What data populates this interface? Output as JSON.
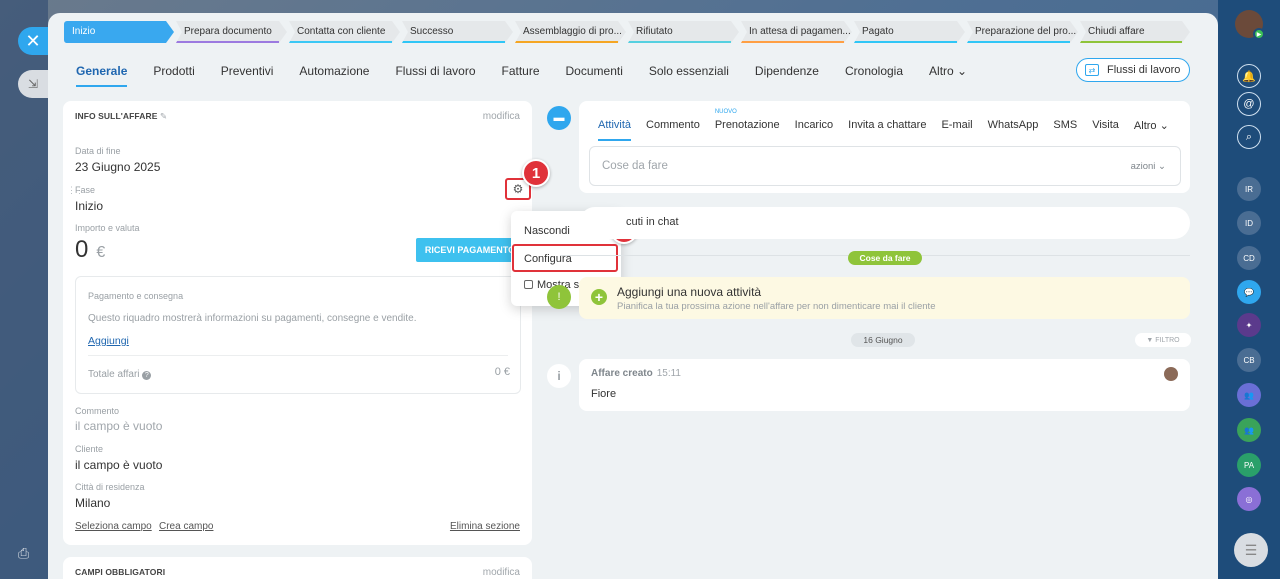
{
  "stages": [
    {
      "label": "Inizio",
      "color": "#39a8ef",
      "active": true
    },
    {
      "label": "Prepara documento",
      "color": "#9c7ae0"
    },
    {
      "label": "Contatta con cliente",
      "color": "#3bc8f5"
    },
    {
      "label": "Successo",
      "color": "#2fc6f6"
    },
    {
      "label": "Assemblaggio di pro...",
      "color": "#f5a623"
    },
    {
      "label": "Rifiutato",
      "color": "#55d0e0"
    },
    {
      "label": "In attesa di pagamen...",
      "color": "#ff9f43"
    },
    {
      "label": "Pagato",
      "color": "#2fc6f6"
    },
    {
      "label": "Preparazione del pro...",
      "color": "#2fc6f6"
    },
    {
      "label": "Chiudi affare",
      "color": "#8fc43a"
    }
  ],
  "tabs": [
    "Generale",
    "Prodotti",
    "Preventivi",
    "Automazione",
    "Flussi di lavoro",
    "Fatture",
    "Documenti",
    "Solo essenziali",
    "Dipendenze",
    "Cronologia",
    "Altro ⌄"
  ],
  "flows_button": "Flussi di lavoro",
  "info": {
    "title": "INFO SULL'AFFARE",
    "edit": "modifica",
    "end_date_label": "Data di fine",
    "end_date_value": "23 Giugno 2025",
    "stage_label": "Fase",
    "stage_value": "Inizio",
    "amount_label": "Importo e valuta",
    "amount_value": "0",
    "currency": "€",
    "pay_button": "RICEVI PAGAMENTO",
    "pay_box": {
      "title": "Pagamento e consegna",
      "desc": "Questo riquadro mostrerà informazioni su pagamenti, consegne e vendite.",
      "add": "Aggiungi",
      "total_label": "Totale affari",
      "total_value": "0 €"
    },
    "comment_label": "Commento",
    "comment_value": "il campo è vuoto",
    "client_label": "Cliente",
    "client_value": "il campo è vuoto",
    "city_label": "Città di residenza",
    "city_value": "Milano",
    "select_field": "Seleziona campo",
    "create_field": "Crea campo",
    "delete_section": "Elimina sezione"
  },
  "required": {
    "title": "CAMPI OBBLIGATORI",
    "edit": "modifica"
  },
  "menu": {
    "hide": "Nascondi",
    "configure": "Configura",
    "always_show": "Mostra sempre"
  },
  "callouts": [
    "1",
    "2"
  ],
  "activity": {
    "tabs": [
      "Attività",
      "Commento",
      "Prenotazione",
      "Incarico",
      "Invita a chattare",
      "E-mail",
      "WhatsApp",
      "SMS",
      "Visita",
      "Altro ⌄"
    ],
    "new_badge": "NUOVO",
    "todo_placeholder": "Cose da fare",
    "actions": "azioni ⌄",
    "chat_text": "cuti in chat",
    "todo_pill": "Cose da fare",
    "new_activity_title": "Aggiungi una nuova attività",
    "new_activity_desc": "Pianifica la tua prossima azione nell'affare per non dimenticare mai il cliente",
    "date_pill": "16 Giugno",
    "filter": "FILTRO",
    "created_title": "Affare creato",
    "created_time": "15:11",
    "created_text": "Fiore"
  },
  "rail": [
    "IR",
    "ID",
    "CD",
    "CB",
    "PA"
  ]
}
